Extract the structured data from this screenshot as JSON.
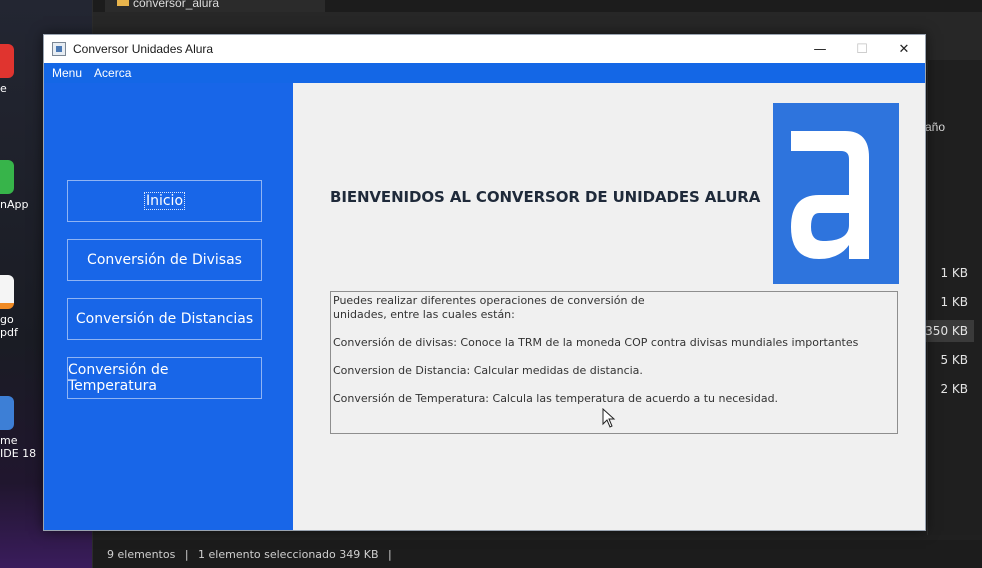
{
  "desktop": {
    "icons": [
      {
        "label": "e",
        "color": "#e0342f"
      },
      {
        "label": "nApp",
        "color": "#37b44a"
      },
      {
        "label": "go\npdf",
        "color": "#f5f5f5"
      },
      {
        "label": "me\nIDE 18",
        "color": "#3d7fd6"
      }
    ]
  },
  "explorer": {
    "tab_title": "conversor_alura",
    "column_header": "año",
    "sizes": [
      "1 KB",
      "1 KB",
      "350 KB",
      "5 KB",
      "2 KB"
    ],
    "selected_index": 2,
    "status": {
      "items": "9 elementos",
      "selection": "1 elemento seleccionado  349 KB"
    }
  },
  "app": {
    "title": "Conversor Unidades Alura",
    "controls": {
      "minimize": "—",
      "maximize": "☐",
      "close": "✕"
    },
    "menu": [
      "Menu",
      "Acerca"
    ],
    "colors": {
      "accent": "#1866e8",
      "logo": "#2e74dd"
    },
    "nav": [
      {
        "label": "Inicio"
      },
      {
        "label": "Conversión de Divisas"
      },
      {
        "label": "Conversión de Distancias"
      },
      {
        "label": "Conversión de Temperatura"
      }
    ],
    "heading": "BIENVENIDOS AL CONVERSOR DE UNIDADES ALURA",
    "logo_letter": "a",
    "info": {
      "line1": "Puedes realizar diferentes operaciones de conversión de",
      "line2": "unidades, entre las cuales están:",
      "line3": "Conversión de divisas: Conoce la TRM de la moneda COP contra divisas mundiales importantes",
      "line4": "Conversion de Distancia: Calcular medidas de distancia.",
      "line5": "Conversión de Temperatura: Calcula las temperatura de acuerdo a tu necesidad."
    }
  }
}
